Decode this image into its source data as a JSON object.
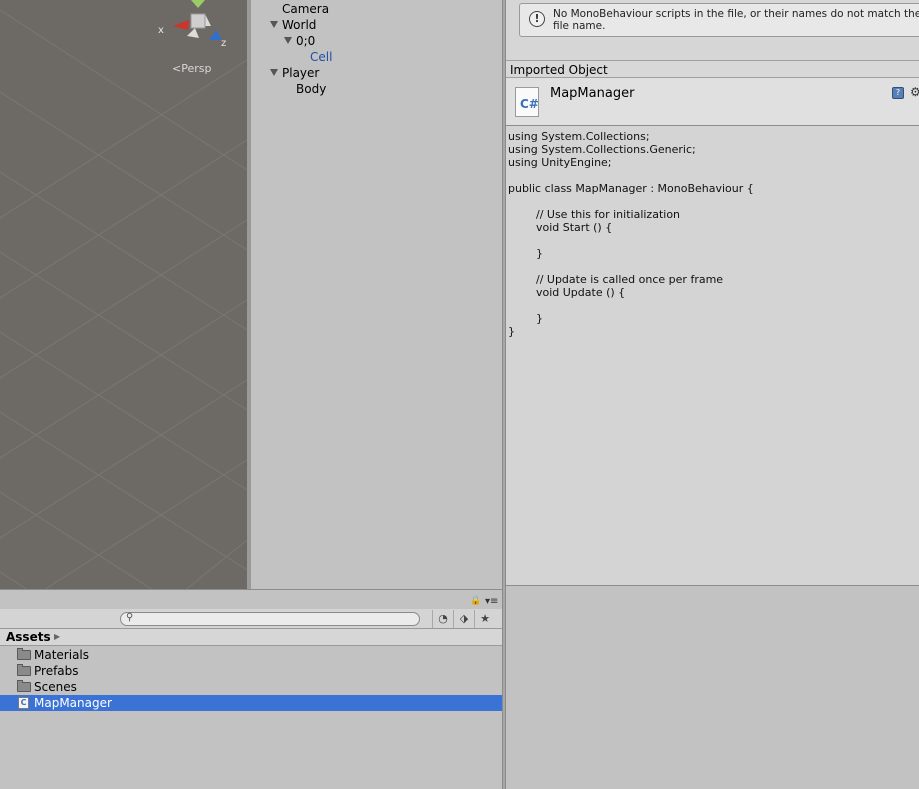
{
  "scene_view": {
    "persp_label": "Persp",
    "gizmo": {
      "x_label": "x",
      "z_label": "z"
    }
  },
  "hierarchy": {
    "items": [
      {
        "label": "Camera",
        "expanded": null
      },
      {
        "label": "World",
        "expanded": true
      },
      {
        "label": "0;0",
        "expanded": true
      },
      {
        "label": "Cell",
        "expanded": null,
        "selected": true
      },
      {
        "label": "Player",
        "expanded": true
      },
      {
        "label": "Body",
        "expanded": null
      }
    ]
  },
  "inspector": {
    "warning": "No MonoBehaviour scripts in the file, or their names do not match the file name.",
    "warning_icon": "!",
    "section_label": "Imported Object",
    "object_name": "MapManager",
    "file_icon_glyph": "C#",
    "code": "using System.Collections;\nusing System.Collections.Generic;\nusing UnityEngine;\n\npublic class MapManager : MonoBehaviour {\n\n\t// Use this for initialization\n\tvoid Start () {\n\t\t\n\t}\n\t\n\t// Update is called once per frame\n\tvoid Update () {\n\t\t\n\t}\n}"
  },
  "project": {
    "search": {
      "value": "",
      "placeholder": ""
    },
    "breadcrumb": "Assets",
    "assets": [
      {
        "label": "Materials",
        "type": "folder"
      },
      {
        "label": "Prefabs",
        "type": "folder"
      },
      {
        "label": "Scenes",
        "type": "folder"
      },
      {
        "label": "MapManager",
        "type": "script",
        "selected": true
      }
    ]
  },
  "colors": {
    "selection": "#3a72d6",
    "hierarchy_selected_text": "#1f4ea7",
    "scene_background": "#6d6a66"
  }
}
